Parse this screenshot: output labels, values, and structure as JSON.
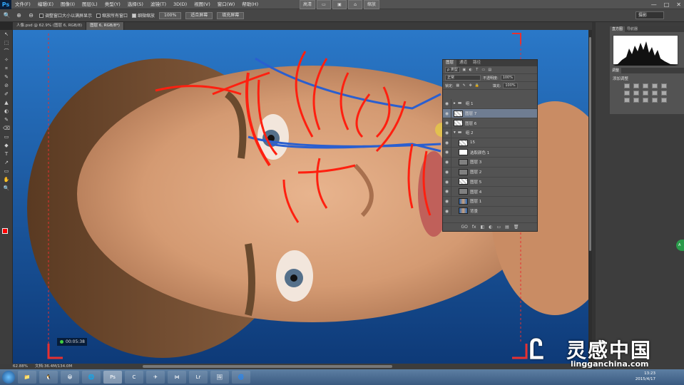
{
  "app": {
    "logo": "Ps"
  },
  "menu": [
    "文件(F)",
    "编辑(E)",
    "图像(I)",
    "图层(L)",
    "类型(Y)",
    "选择(S)",
    "滤镜(T)",
    "3D(D)",
    "视图(V)",
    "窗口(W)",
    "帮助(H)"
  ],
  "center_tools": [
    "高清",
    "",
    "",
    "",
    "缩放"
  ],
  "window_buttons": [
    "—",
    "□",
    "✕"
  ],
  "options": {
    "zoom_icon": "🔍",
    "resize_windows": "调整窗口大小以满屏显示",
    "zoom_all": "缩放所有窗口",
    "scrubby_zoom": "细微缩放",
    "pct_btn": "100%",
    "fit_btn": "适合屏幕",
    "fill_btn": "填充屏幕",
    "workspace": "摄影"
  },
  "tabs": [
    {
      "label": "人像.psd @ 62.9% (图层 6, RGB/8)"
    },
    {
      "label": "图层 6, RGB/8*)",
      "active": true
    }
  ],
  "tools": [
    "↖",
    "⬚",
    "⌒",
    "✧",
    "⌗",
    "✎",
    "⊘",
    "✐",
    "▲",
    "◐",
    "✎",
    "⌫",
    "▭",
    "◆",
    "T",
    "↗",
    "▭",
    "✋",
    "🔍"
  ],
  "canvas": {
    "timer": "00:05:38"
  },
  "layers_panel": {
    "tabs": [
      "图层",
      "通道",
      "路径"
    ],
    "kind_label": "ρ 类型",
    "blend_mode": "正常",
    "opacity_label": "不透明度:",
    "opacity_value": "100%",
    "lock_label": "锁定:",
    "fill_label": "填充:",
    "fill_value": "100%",
    "layers": [
      {
        "name": "组 1",
        "type": "folder",
        "collapsed": true
      },
      {
        "name": "图层 7",
        "type": "checker",
        "selected": true
      },
      {
        "name": "图层 6",
        "type": "checker"
      },
      {
        "name": "组 2",
        "type": "folder",
        "collapsed": false
      },
      {
        "name": "15",
        "type": "checker"
      },
      {
        "name": "选取颜色 1",
        "type": "white"
      },
      {
        "name": "图层 3",
        "type": "gray"
      },
      {
        "name": "图层 2",
        "type": "gray"
      },
      {
        "name": "图层 5",
        "type": "checker"
      },
      {
        "name": "图层 4",
        "type": "gray"
      },
      {
        "name": "图层 1",
        "type": "photo"
      },
      {
        "name": "背景",
        "type": "photo"
      }
    ],
    "footer_icons": [
      "GO",
      "fx",
      "◧",
      "◐",
      "▭",
      "▤",
      "🗑"
    ]
  },
  "right_panels": {
    "hist_tabs": [
      "直方图",
      "导航器"
    ],
    "adj_tab": "调整",
    "adj_title": "添加调整"
  },
  "status": {
    "zoom": "62.88%",
    "doc": "文档:36.4M/134.0M"
  },
  "taskbar": {
    "apps": [
      "📁",
      "🐧",
      "😀",
      "🌐",
      "Ps",
      "C",
      "✈",
      "⋈",
      "Lr",
      "🖼",
      "🌀"
    ],
    "time": "13:23",
    "date": "2015/4/17"
  },
  "watermark": {
    "cn": "灵感中国",
    "url": "lingganchina.com"
  },
  "side_button": "A"
}
